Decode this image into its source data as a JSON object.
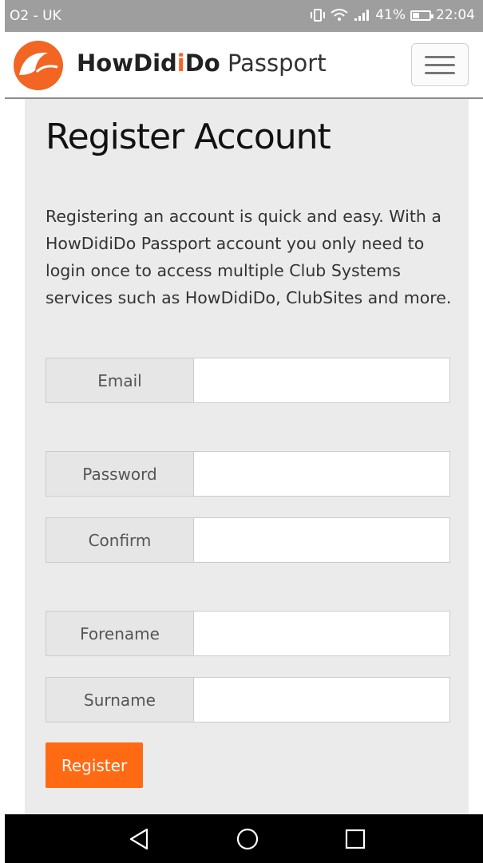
{
  "status_bar": {
    "carrier": "O2 - UK",
    "battery_percent": "41%",
    "battery_level": 0.41,
    "time": "22:04"
  },
  "app_bar": {
    "brand_how": "How",
    "brand_didi": "Did",
    "brand_i": "i",
    "brand_do": "Do",
    "brand_passport": " Passport",
    "menu_icon": "hamburger-menu-icon",
    "logo_icon": "howdidido-logo"
  },
  "page": {
    "title": "Register Account",
    "intro": "Registering an account is quick and easy. With a HowDidiDo Passport account you only need to login once to access multiple Club Systems services such as HowDidiDo, ClubSites and more."
  },
  "form": {
    "email_label": "Email",
    "email_value": "",
    "password_label": "Password",
    "password_value": "",
    "confirm_label": "Confirm",
    "confirm_value": "",
    "forename_label": "Forename",
    "forename_value": "",
    "surname_label": "Surname",
    "surname_value": "",
    "register_label": "Register"
  },
  "colors": {
    "accent": "#ff6a13",
    "status_bar": "#9e9e9e",
    "content_bg": "#ebebeb"
  },
  "nav_bar": {
    "back_icon": "back-triangle-icon",
    "home_icon": "home-circle-icon",
    "recents_icon": "recents-square-icon"
  }
}
